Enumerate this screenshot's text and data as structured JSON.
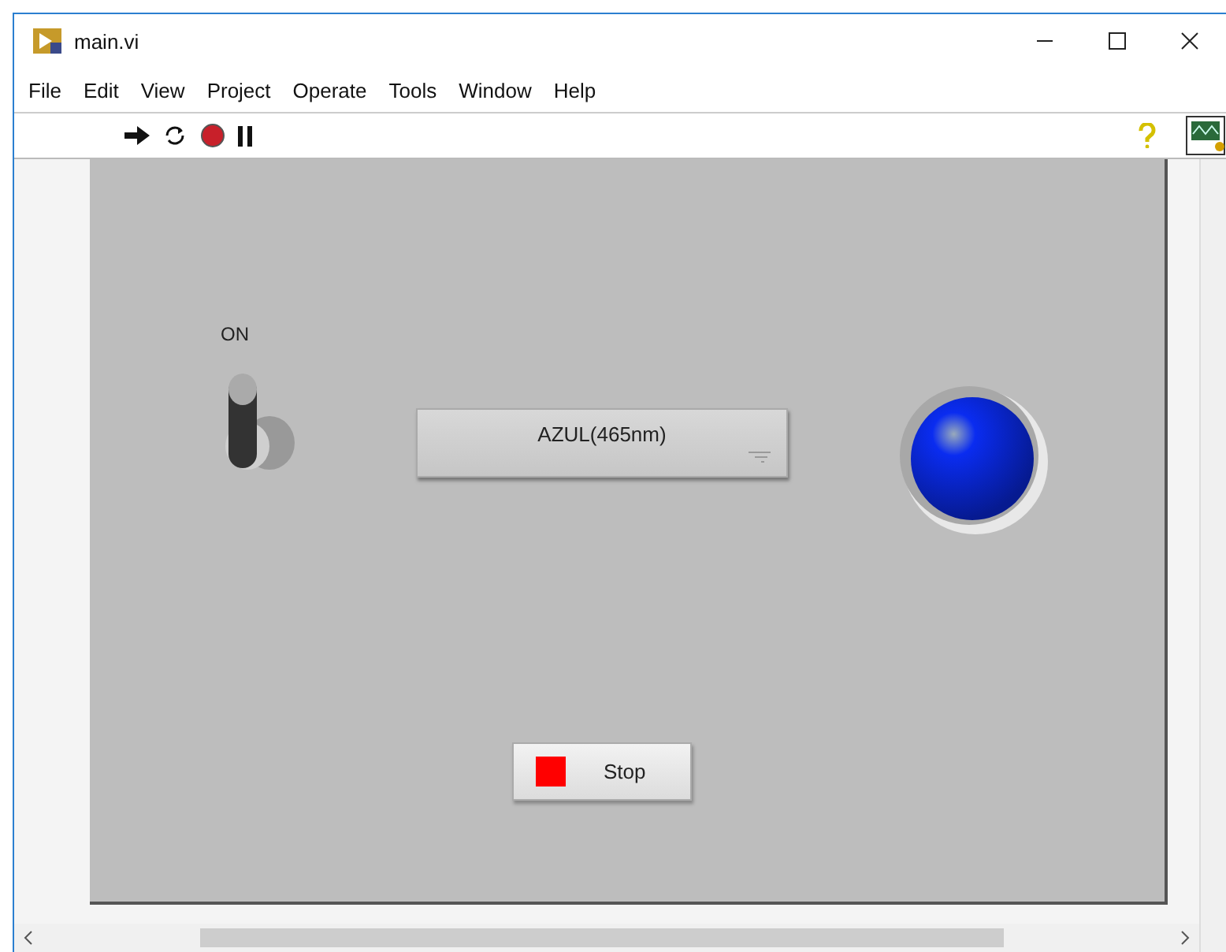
{
  "window": {
    "title": "main.vi"
  },
  "menu": [
    "File",
    "Edit",
    "View",
    "Project",
    "Operate",
    "Tools",
    "Window",
    "Help"
  ],
  "toggle": {
    "label": "ON",
    "on": true
  },
  "ring": {
    "value": "AZUL(465nm)"
  },
  "led": {
    "on": true,
    "color": "#0a2cf0"
  },
  "stop_button": {
    "label": "Stop"
  }
}
